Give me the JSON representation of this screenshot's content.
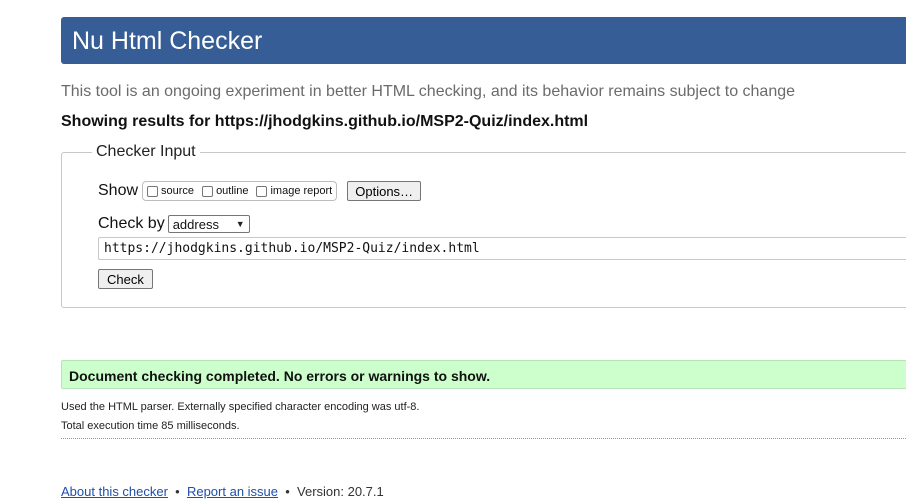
{
  "header": {
    "title": "Nu Html Checker",
    "color": "#365d95"
  },
  "intro": "This tool is an ongoing experiment in better HTML checking, and its behavior remains subject to change",
  "results_for": "Showing results for https://jhodgkins.github.io/MSP2-Quiz/index.html",
  "checker_input": {
    "legend": "Checker Input",
    "show_label": "Show",
    "show_options": [
      {
        "label": "source",
        "checked": false
      },
      {
        "label": "outline",
        "checked": false
      },
      {
        "label": "image report",
        "checked": false
      }
    ],
    "options_button": "Options…",
    "check_by_label": "Check by",
    "check_by_value": "address",
    "url_value": "https://jhodgkins.github.io/MSP2-Quiz/index.html",
    "check_button": "Check"
  },
  "result": {
    "message": "Document checking completed. No errors or warnings to show.",
    "color": "#ccffcc"
  },
  "details": {
    "parser": "Used the HTML parser. Externally specified character encoding was utf-8.",
    "time": "Total execution time 85 milliseconds."
  },
  "footer": {
    "about": "About this checker",
    "report": "Report an issue",
    "version": "Version: 20.7.1"
  }
}
